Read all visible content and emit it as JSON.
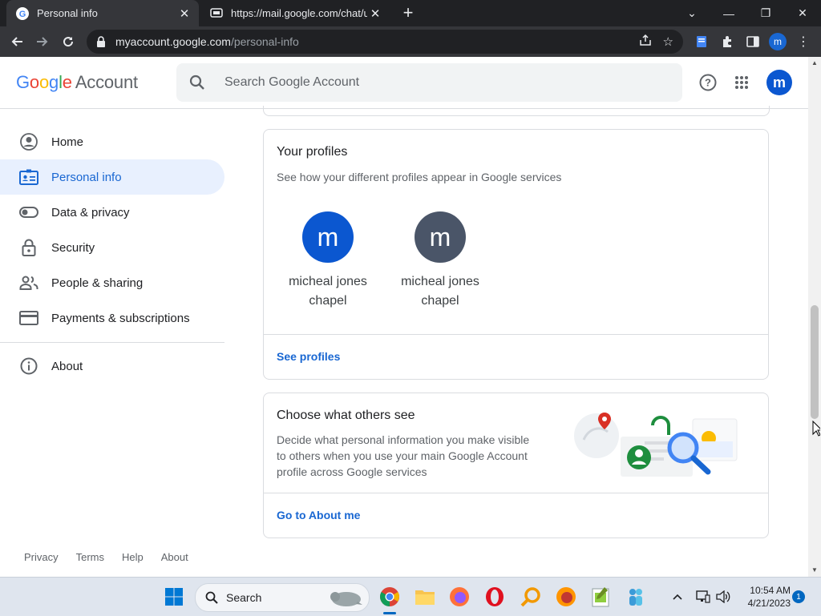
{
  "browser": {
    "tabs": [
      {
        "title": "Personal info",
        "active": true
      },
      {
        "title": "https://mail.google.com/chat/u/0",
        "active": false
      }
    ],
    "url_host": "myaccount.google.com",
    "url_path": "/personal-info",
    "profile_initial": "m"
  },
  "header": {
    "logo_google": "Google",
    "logo_account": "Account",
    "search_placeholder": "Search Google Account",
    "avatar_initial": "m"
  },
  "sidebar": {
    "items": [
      {
        "label": "Home",
        "icon": "account-circle-icon",
        "active": false
      },
      {
        "label": "Personal info",
        "icon": "badge-icon",
        "active": true
      },
      {
        "label": "Data & privacy",
        "icon": "toggle-icon",
        "active": false
      },
      {
        "label": "Security",
        "icon": "lock-icon",
        "active": false
      },
      {
        "label": "People & sharing",
        "icon": "people-icon",
        "active": false
      },
      {
        "label": "Payments & subscriptions",
        "icon": "credit-card-icon",
        "active": false
      },
      {
        "label": "About",
        "icon": "info-icon",
        "active": false
      }
    ],
    "footer": [
      "Privacy",
      "Terms",
      "Help",
      "About"
    ]
  },
  "profiles_card": {
    "title": "Your profiles",
    "description": "See how your different profiles appear in Google services",
    "profiles": [
      {
        "initial": "m",
        "name_line1": "micheal jones",
        "name_line2": "chapel",
        "color": "#0b57d0"
      },
      {
        "initial": "m",
        "name_line1": "micheal jones",
        "name_line2": "chapel",
        "color": "#4a5568"
      }
    ],
    "link": "See profiles"
  },
  "others_card": {
    "title": "Choose what others see",
    "description_lines": [
      "Decide what personal information you make visible",
      "to others when you use your main Google Account",
      "profile across Google services"
    ],
    "link": "Go to About me"
  },
  "taskbar": {
    "search_label": "Search",
    "time": "10:54 AM",
    "date": "4/21/2023",
    "notification_count": "1"
  },
  "colors": {
    "accent": "#1967d2",
    "active_nav_bg": "#e8f0fe",
    "chrome_dark": "#202124"
  }
}
